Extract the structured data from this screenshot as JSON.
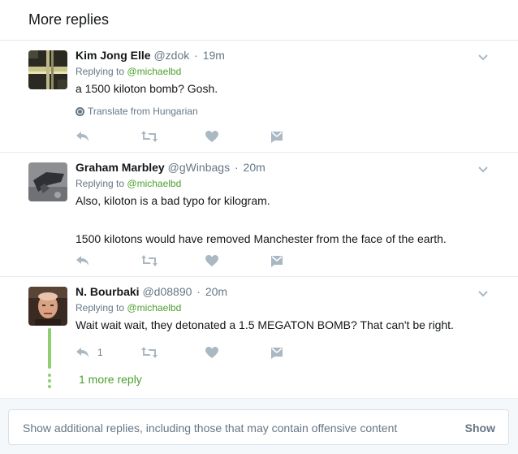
{
  "header": {
    "title": "More replies"
  },
  "replying_label": "Replying to",
  "tweets": [
    {
      "name": "Kim Jong Elle",
      "handle": "@zdok",
      "time": "19m",
      "reply_to": "@michaelbd",
      "text": "a 1500 kiloton bomb? Gosh.",
      "translate": "Translate from Hungarian"
    },
    {
      "name": "Graham Marbley",
      "handle": "@gWinbags",
      "time": "20m",
      "reply_to": "@michaelbd",
      "text_lines": [
        "Also, kiloton is a bad typo for kilogram.",
        "1500 kilotons would have removed Manchester from the face of the earth."
      ]
    },
    {
      "name": "N. Bourbaki",
      "handle": "@d08890",
      "time": "20m",
      "reply_to": "@michaelbd",
      "text": "Wait wait wait, they detonated a 1.5 MEGATON BOMB? That can't be right.",
      "reply_count": "1"
    }
  ],
  "more_reply": "1 more reply",
  "footer": {
    "text": "Show additional replies, including those that may contain offensive content",
    "button": "Show"
  },
  "colors": {
    "accent_green": "#4ca02c",
    "thread_line": "#8fcf74",
    "muted": "#657786",
    "icon": "#aab8c2"
  },
  "icons": [
    "reply-icon",
    "retweet-icon",
    "like-icon",
    "dm-icon",
    "caret-down-icon",
    "globe-icon"
  ]
}
